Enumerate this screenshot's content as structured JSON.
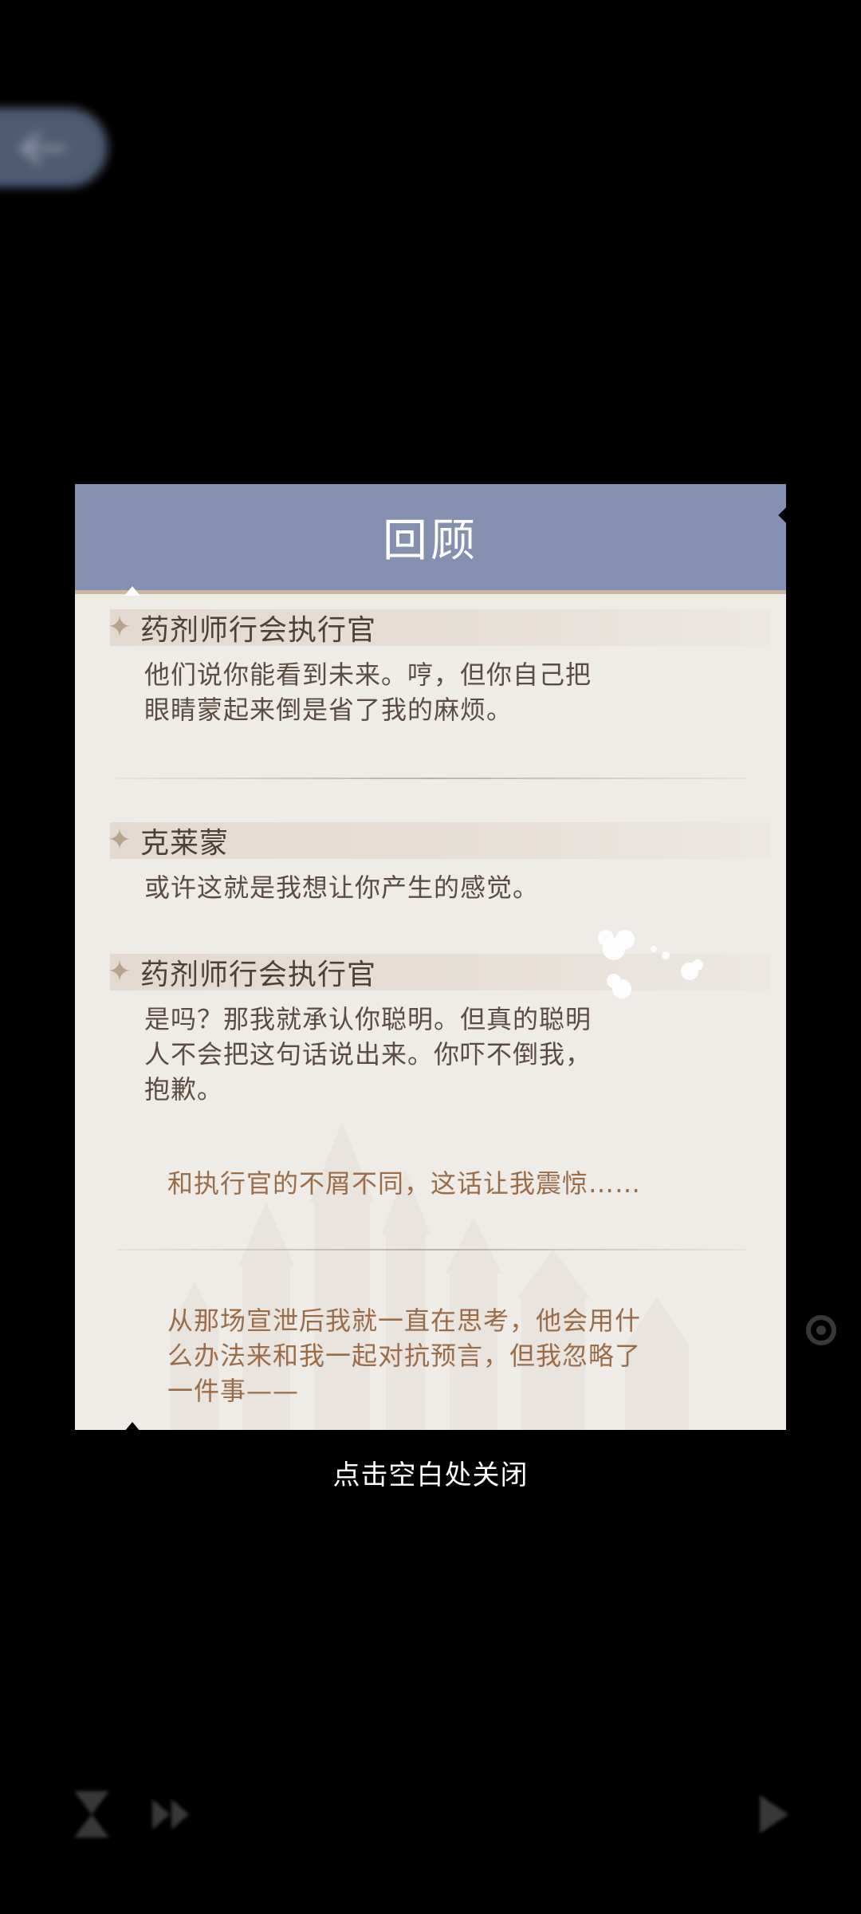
{
  "dialog": {
    "title": "回顾",
    "entries": [
      {
        "speaker": "药剂师行会执行官",
        "text_lines": [
          "他们说你能看到未来。哼，但你自己把",
          "眼睛蒙起来倒是省了我的麻烦。"
        ]
      },
      {
        "speaker": "克莱蒙",
        "text_lines": [
          "或许这就是我想让你产生的感觉。"
        ]
      },
      {
        "speaker": "药剂师行会执行官",
        "text_lines": [
          "是吗？那我就承认你聪明。但真的聪明",
          "人不会把这句话说出来。你吓不倒我，",
          "抱歉。"
        ]
      }
    ],
    "narration_1": "和执行官的不屑不同，这话让我震惊……",
    "narration_2_lines": [
      "从那场宣泄后我就一直在思考，他会用什",
      "么办法来和我一起对抗预言，但我忽略了",
      "一件事——"
    ]
  },
  "close_hint": "点击空白处关闭",
  "icons": {
    "back": "back-arrow-icon",
    "speaker_marker": "sparkle-star-icon",
    "bottom_left": "hourglass-icon",
    "bottom_left_2": "skip-icon",
    "bottom_right": "play-icon",
    "side": "settings-gear-icon"
  },
  "colors": {
    "header": "#8590b0",
    "panel": "#efebe7",
    "narration": "#9a6d48",
    "dialogue": "#5a4c43"
  }
}
